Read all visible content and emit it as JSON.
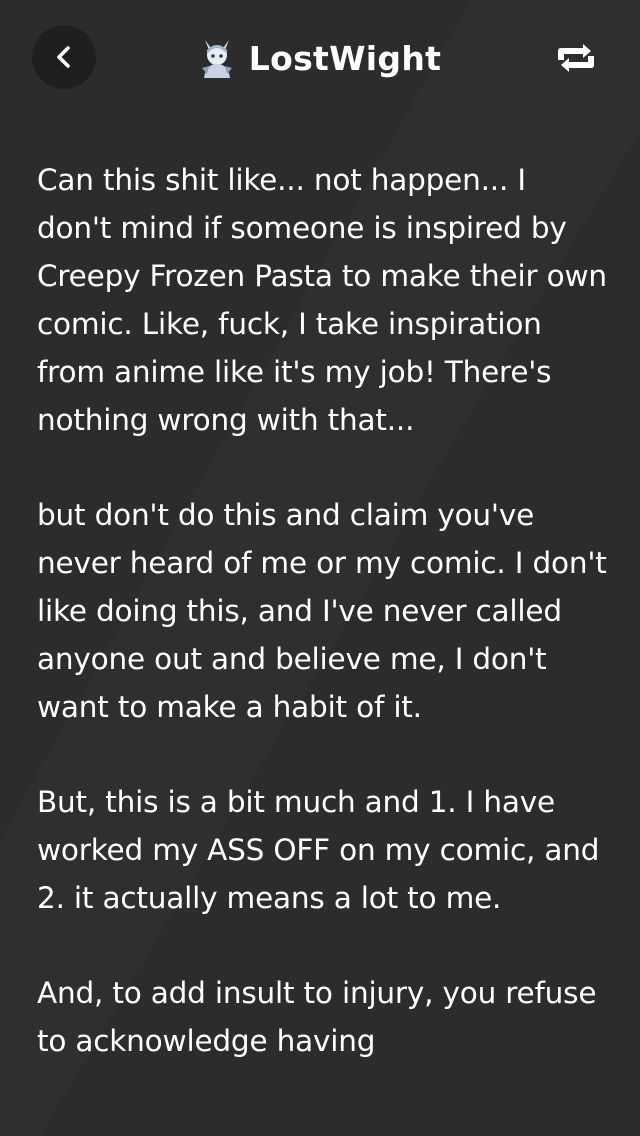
{
  "header": {
    "title": "LostWight",
    "back_icon": "chevron-left-icon",
    "reblog_icon": "reblog-icon",
    "avatar_icon": "avatar-icon"
  },
  "colors": {
    "background": "#2c2c2c",
    "back_button": "#1f1f1f",
    "text": "#ffffff"
  },
  "post": {
    "paragraphs": [
      "Can this shit like... not happen... I don't mind if someone is inspired by Creepy Frozen Pasta to make their own comic. Like, fuck, I take inspiration from anime like it's my job! There's nothing wrong with that...",
      "but don't do this and claim you've never heard of me or my comic. I don't like doing this, and I've never called anyone out and believe me, I don't want to make a habit of it.",
      "But, this is a bit much and 1. I have worked my ASS OFF on my comic, and 2. it actually means a lot to me.",
      "And, to add insult to injury, you refuse to acknowledge having"
    ]
  }
}
